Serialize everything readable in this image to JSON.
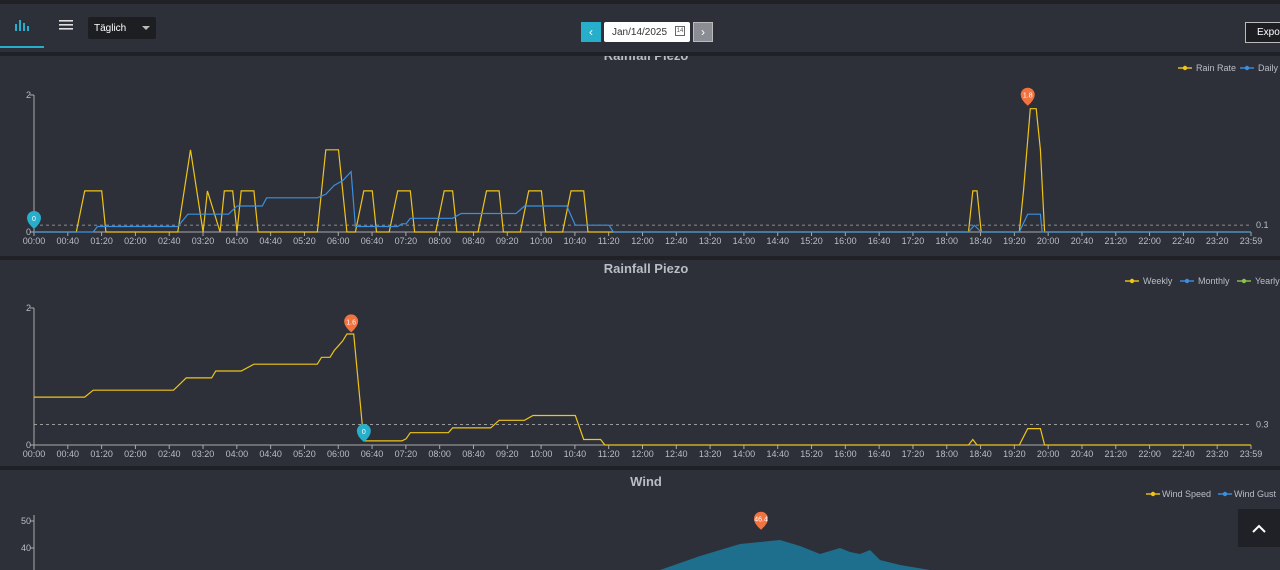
{
  "toolbar": {
    "chart_icon": "bar-chart-icon",
    "menu_icon": "menu-icon",
    "period_select": "Täglich",
    "prev_label": "‹",
    "next_label": "›",
    "date_value": "Jan/14/2025",
    "calendar_icon": "calendar-icon",
    "calendar_label": "14",
    "export_label": "Export"
  },
  "time_labels": [
    "00:00",
    "00:40",
    "01:20",
    "02:00",
    "02:40",
    "03:20",
    "04:00",
    "04:40",
    "05:20",
    "06:00",
    "06:40",
    "07:20",
    "08:00",
    "08:40",
    "09:20",
    "10:00",
    "10:40",
    "11:20",
    "12:00",
    "12:40",
    "13:20",
    "14:00",
    "14:40",
    "15:20",
    "16:00",
    "16:40",
    "17:20",
    "18:00",
    "18:40",
    "19:20",
    "20:00",
    "20:40",
    "21:20",
    "22:00",
    "22:40",
    "23:20",
    "23:59"
  ],
  "colors": {
    "yellow": "#f0c419",
    "blue": "#3b8fe0",
    "green": "#8bc34a",
    "max_marker": "#f27340",
    "min_marker": "#27aeca",
    "wind_fill": "#1e6e8e"
  },
  "chart_data": [
    {
      "type": "line",
      "title": "Rainfall Piezo",
      "legend": [
        "Rain Rate",
        "Daily"
      ],
      "legend_position": "top-right",
      "x_unit": "minutes since 00:00",
      "yticks": [
        "2",
        "0"
      ],
      "ylim": [
        0,
        2
      ],
      "markline": {
        "value": 0.1,
        "label": "0.1"
      },
      "max_marker": {
        "label": "1.8",
        "x": 1175,
        "y": 1.8
      },
      "min_marker": {
        "label": "0",
        "x": 0,
        "y": 0
      },
      "series": [
        {
          "name": "Rain Rate",
          "color": "#f0c419",
          "points": [
            [
              0,
              0
            ],
            [
              50,
              0
            ],
            [
              60,
              0.6
            ],
            [
              80,
              0.6
            ],
            [
              85,
              0
            ],
            [
              170,
              0
            ],
            [
              185,
              1.2
            ],
            [
              200,
              0
            ],
            [
              205,
              0.6
            ],
            [
              220,
              0
            ],
            [
              225,
              0.6
            ],
            [
              235,
              0.6
            ],
            [
              240,
              0
            ],
            [
              245,
              0.6
            ],
            [
              260,
              0.6
            ],
            [
              265,
              0
            ],
            [
              335,
              0
            ],
            [
              345,
              1.2
            ],
            [
              360,
              1.2
            ],
            [
              370,
              0
            ],
            [
              380,
              0
            ],
            [
              390,
              0.6
            ],
            [
              400,
              0.6
            ],
            [
              405,
              0
            ],
            [
              420,
              0
            ],
            [
              430,
              0.6
            ],
            [
              445,
              0.6
            ],
            [
              450,
              0
            ],
            [
              475,
              0
            ],
            [
              485,
              0.6
            ],
            [
              495,
              0.6
            ],
            [
              500,
              0
            ],
            [
              525,
              0
            ],
            [
              535,
              0.6
            ],
            [
              550,
              0.6
            ],
            [
              555,
              0
            ],
            [
              575,
              0
            ],
            [
              585,
              0.6
            ],
            [
              600,
              0.6
            ],
            [
              605,
              0
            ],
            [
              625,
              0
            ],
            [
              635,
              0.6
            ],
            [
              650,
              0.6
            ],
            [
              655,
              0
            ],
            [
              1105,
              0
            ],
            [
              1110,
              0.6
            ],
            [
              1115,
              0.6
            ],
            [
              1120,
              0
            ],
            [
              1165,
              0
            ],
            [
              1170,
              0.6
            ],
            [
              1178,
              1.8
            ],
            [
              1185,
              1.8
            ],
            [
              1190,
              1.2
            ],
            [
              1195,
              0
            ],
            [
              1439,
              0
            ]
          ]
        },
        {
          "name": "Daily",
          "color": "#3b8fe0",
          "points": [
            [
              0,
              0
            ],
            [
              70,
              0
            ],
            [
              75,
              0.08
            ],
            [
              120,
              0.08
            ],
            [
              170,
              0.08
            ],
            [
              182,
              0.26
            ],
            [
              230,
              0.26
            ],
            [
              240,
              0.38
            ],
            [
              270,
              0.38
            ],
            [
              275,
              0.5
            ],
            [
              335,
              0.5
            ],
            [
              345,
              0.55
            ],
            [
              355,
              0.68
            ],
            [
              365,
              0.75
            ],
            [
              375,
              0.88
            ],
            [
              380,
              0.08
            ],
            [
              430,
              0.08
            ],
            [
              435,
              0.12
            ],
            [
              440,
              0.12
            ],
            [
              445,
              0.2
            ],
            [
              495,
              0.2
            ],
            [
              505,
              0.27
            ],
            [
              570,
              0.27
            ],
            [
              580,
              0.38
            ],
            [
              630,
              0.38
            ],
            [
              640,
              0.1
            ],
            [
              680,
              0.1
            ],
            [
              685,
              0
            ],
            [
              1105,
              0
            ],
            [
              1112,
              0.1
            ],
            [
              1120,
              0
            ],
            [
              1165,
              0
            ],
            [
              1175,
              0.26
            ],
            [
              1190,
              0.26
            ],
            [
              1192,
              0
            ],
            [
              1439,
              0
            ]
          ]
        }
      ]
    },
    {
      "type": "line",
      "title": "Rainfall Piezo",
      "legend": [
        "Weekly",
        "Monthly",
        "Yearly"
      ],
      "legend_position": "top-right",
      "x_unit": "minutes since 00:00",
      "yticks": [
        "2",
        "0"
      ],
      "ylim": [
        0,
        2
      ],
      "markline": {
        "value": 0.3,
        "label": "0.3"
      },
      "max_marker": {
        "label": "1.6",
        "x": 375,
        "y": 1.6
      },
      "min_marker": {
        "label": "0",
        "x": 390,
        "y": 0
      },
      "series": [
        {
          "name": "Weekly",
          "color": "#f0c419",
          "points": [
            [
              0,
              0.7
            ],
            [
              60,
              0.7
            ],
            [
              70,
              0.8
            ],
            [
              165,
              0.8
            ],
            [
              170,
              0.86
            ],
            [
              180,
              0.98
            ],
            [
              210,
              0.98
            ],
            [
              215,
              1.08
            ],
            [
              245,
              1.08
            ],
            [
              260,
              1.18
            ],
            [
              335,
              1.18
            ],
            [
              340,
              1.28
            ],
            [
              350,
              1.28
            ],
            [
              355,
              1.38
            ],
            [
              360,
              1.45
            ],
            [
              365,
              1.52
            ],
            [
              370,
              1.62
            ],
            [
              378,
              1.62
            ],
            [
              390,
              0.06
            ],
            [
              435,
              0.06
            ],
            [
              440,
              0.09
            ],
            [
              445,
              0.18
            ],
            [
              490,
              0.18
            ],
            [
              495,
              0.25
            ],
            [
              540,
              0.25
            ],
            [
              550,
              0.36
            ],
            [
              580,
              0.36
            ],
            [
              590,
              0.43
            ],
            [
              640,
              0.43
            ],
            [
              650,
              0.08
            ],
            [
              670,
              0.08
            ],
            [
              675,
              0
            ],
            [
              1105,
              0
            ],
            [
              1110,
              0.08
            ],
            [
              1115,
              0
            ],
            [
              1165,
              0
            ],
            [
              1175,
              0.24
            ],
            [
              1190,
              0.24
            ],
            [
              1195,
              0
            ],
            [
              1439,
              0
            ]
          ]
        }
      ]
    },
    {
      "type": "area",
      "title": "Wind",
      "legend": [
        "Wind Speed",
        "Wind Gust"
      ],
      "legend_position": "top-right",
      "yticks": [
        "50",
        "40"
      ],
      "ylim": [
        0,
        50
      ],
      "max_marker": {
        "label": "46.4",
        "x": 860,
        "y": 46.4
      }
    }
  ]
}
